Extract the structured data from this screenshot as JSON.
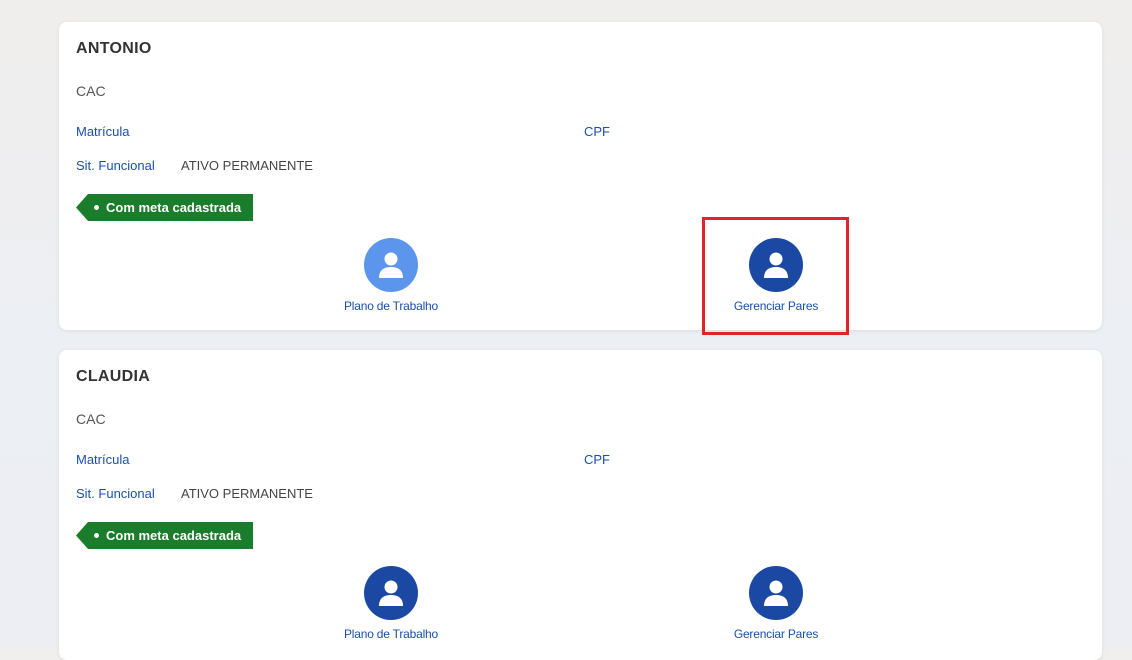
{
  "colors": {
    "page_bg": "#f1efed",
    "card_bg": "#ffffff",
    "label_blue": "#1b4fa8",
    "tag_green": "#1a7d2b",
    "icon_light_blue": "#5b96ec",
    "icon_dark_blue": "#1a48a3",
    "highlight_red": "#e0242a"
  },
  "cards": [
    {
      "name": "ANTONIO",
      "unit": "CAC",
      "matricula_label": "Matrícula",
      "cpf_label": "CPF",
      "sit_label": "Sit. Funcional",
      "sit_value": "ATIVO PERMANENTE",
      "tag": "Com meta cadastrada",
      "actions": [
        {
          "label": "Plano de Trabalho",
          "icon": "user-icon",
          "style": "light"
        },
        {
          "label": "Gerenciar Pares",
          "icon": "user-icon",
          "style": "dark",
          "highlighted": true
        }
      ]
    },
    {
      "name": "CLAUDIA",
      "unit": "CAC",
      "matricula_label": "Matrícula",
      "cpf_label": "CPF",
      "sit_label": "Sit. Funcional",
      "sit_value": "ATIVO PERMANENTE",
      "tag": "Com meta cadastrada",
      "actions": [
        {
          "label": "Plano de Trabalho",
          "icon": "user-icon",
          "style": "dark"
        },
        {
          "label": "Gerenciar Pares",
          "icon": "user-icon",
          "style": "dark"
        }
      ]
    }
  ]
}
